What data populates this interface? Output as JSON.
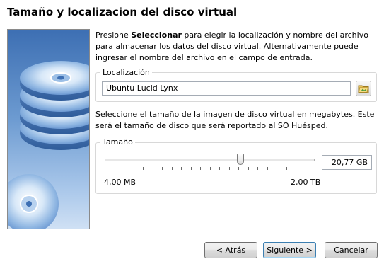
{
  "dialog": {
    "title": "Tamaño y localizacion del disco virtual"
  },
  "location": {
    "desc_pre": "Presione ",
    "desc_bold": "Seleccionar",
    "desc_post": " para elegir la localización y nombre del archivo para almacenar los datos del disco virtual. Alternativamente puede ingresar el nombre del archivo en el campo de entrada.",
    "group_label": "Localización",
    "value": "Ubuntu Lucid Lynx",
    "select_icon": "folder-browse-icon"
  },
  "size": {
    "desc": "Seleccione el tamaño de la imagen de disco virtual en megabytes. Este será el tamaño de disco que será reportado al SO Huésped.",
    "group_label": "Tamaño",
    "value": "20,77 GB",
    "min_label": "4,00 MB",
    "max_label": "2,00 TB",
    "slider_fraction": 0.645
  },
  "buttons": {
    "back": "< Atrás",
    "next": "Siguiente >",
    "cancel": "Cancelar"
  }
}
